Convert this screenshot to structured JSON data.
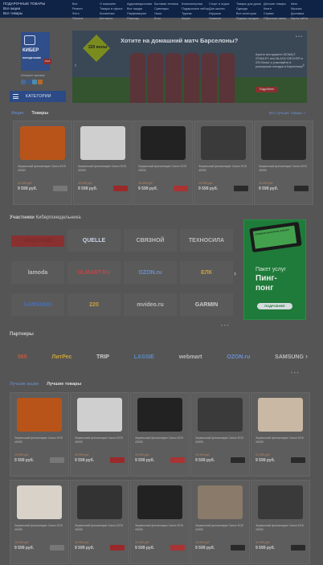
{
  "topbar": {
    "left_links": [
      "ПОДАРОЧНЫЕ ТОВАРЫ",
      "Все акции",
      "Все товары"
    ],
    "menu": [
      "Все",
      "О магазине",
      "Аудиовизуальная",
      "Бытовая техника",
      "Компьютерная",
      "Спорт и отдых",
      "Товары для дома",
      "Детские товары",
      "Авто",
      "Ремонт",
      "Товары в офисе",
      "Все скидки",
      "Сувениры",
      "Подарочные наборы",
      "Для школы",
      "Одежда",
      "Книги",
      "Музыка",
      "Фото",
      "Косметика",
      "Парфюмерия",
      "Часы",
      "Туризм",
      "Игрушки",
      "Все категории",
      "Сервис",
      "Доставка",
      "Оплата",
      "Контакты",
      "Помощь",
      "Блог",
      "Акции",
      "Новинки",
      "Лидеры продаж",
      "Обратная связь",
      "Карта сайта"
    ]
  },
  "logo": {
    "line1": "КИБЕР",
    "line2": "понедельник",
    "badge": "2018",
    "caption": "Интернет-магазин"
  },
  "categories_button": "КАТЕГОРИИ",
  "banner": {
    "title": "Хотите на домашний матч Барселоны?",
    "logo_text": "220 вольт",
    "description": "Купите инструмент DEWALT, STANLEY или BLACK+DECKER в 220 Вольт и участвуйте в розыгрыше поездки в Барселону!",
    "button": "Подробнее",
    "dots": "• • •"
  },
  "tabs": {
    "items": [
      "Акции",
      "Товары"
    ],
    "more": "Все лучшие товары »"
  },
  "product_name": "Зеркальный фотоаппарат Canon EOS 4000D",
  "old_price": "16 999 руб.",
  "price": "9 599 руб.",
  "products_row1": [
    {
      "img": "#b8541a",
      "tag": "#777"
    },
    {
      "img": "#cfcfcf",
      "tag": "#9a2a2a"
    },
    {
      "img": "#222",
      "tag": "#a33"
    },
    {
      "img": "#3a3a3a",
      "tag": "#2a2a2a"
    },
    {
      "img": "#2b2b2b",
      "tag": "#2a2a2a"
    }
  ],
  "participants": {
    "title": "Участники",
    "subtitle": "Киберпонедельника"
  },
  "brands": [
    "ЭЛЬДОРАДО",
    "QUELLE",
    "СВЯЗНОЙ",
    "ТЕХНОСИЛА",
    "lamoda",
    "ULMART.RU",
    "OZON.ru",
    "ЕЛК",
    "SAMSUNG",
    "220",
    "mvideo.ru",
    "GARMIN"
  ],
  "ad": {
    "line1": "Пакет услуг",
    "line2": "Пинг-",
    "line3": "понг",
    "button": "ПОДРОБНЕЕ",
    "screen": "Операция выполнена успешно"
  },
  "partners": {
    "title": "Партнеры",
    "items": [
      "565",
      "ЛитРес",
      "TRIP",
      "LASSIE",
      "webmart",
      "OZON.ru",
      "SAMSUNG"
    ]
  },
  "tabs2": {
    "items": [
      "Лучшие акции",
      "Лучшие товары"
    ]
  },
  "products_row2": [
    {
      "img": "#b8541a",
      "tag": "#777"
    },
    {
      "img": "#cfcfcf",
      "tag": "#9a2a2a"
    },
    {
      "img": "#222",
      "tag": "#a33"
    },
    {
      "img": "#3a3a3a",
      "tag": "#2a2a2a"
    },
    {
      "img": "#c9b8a3",
      "tag": "#2a2a2a"
    }
  ],
  "products_row3": [
    {
      "img": "#d8d2c8",
      "tag": "#777"
    },
    {
      "img": "#333",
      "tag": "#9a2a2a"
    },
    {
      "img": "#222",
      "tag": "#a33"
    },
    {
      "img": "#8a7a6a",
      "tag": "#2a2a2a"
    },
    {
      "img": "#3a3a3a",
      "tag": "#2a2a2a"
    }
  ]
}
